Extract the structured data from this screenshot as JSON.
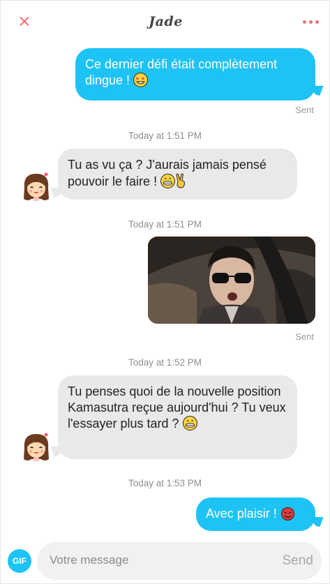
{
  "header": {
    "title": "Jade",
    "accent": "#f06a6a"
  },
  "messages": [
    {
      "kind": "out",
      "text": "Ce dernier défi était complètement dingue !",
      "emoji": "star-struck",
      "status": "Sent"
    },
    {
      "kind": "timestamp",
      "text": "Today at 1:51 PM"
    },
    {
      "kind": "in",
      "text": "Tu as vu ça ? J'aurais jamais pensé pouvoir le faire !",
      "emoji": "grin-victory"
    },
    {
      "kind": "timestamp",
      "text": "Today at 1:51 PM"
    },
    {
      "kind": "out-image",
      "image": "man-in-sunglasses-in-car",
      "status": "Sent"
    },
    {
      "kind": "timestamp",
      "text": "Today at 1:52 PM"
    },
    {
      "kind": "in",
      "text": "Tu penses quoi de la nouvelle position Kamasutra reçue aujourd'hui ? Tu veux l'essayer plus tard ?",
      "emoji": "grin"
    },
    {
      "kind": "timestamp",
      "text": "Today at 1:53 PM"
    },
    {
      "kind": "out",
      "text": "Avec plaisir !",
      "emoji": "smiling-devil"
    }
  ],
  "composer": {
    "gif_label": "GIF",
    "placeholder": "Votre message",
    "send_label": "Send"
  },
  "colors": {
    "outgoing": "#1ec3f5",
    "incoming": "#e9e9eb"
  }
}
